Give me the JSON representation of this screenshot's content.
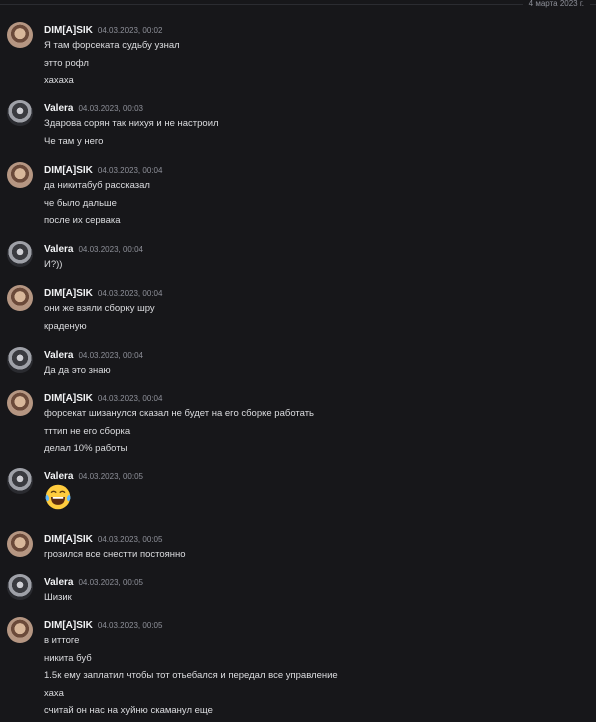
{
  "date_divider": "4 марта 2023 г.",
  "messages": [
    {
      "author": "DIM[A]SIK",
      "time": "04.03.2023, 00:02",
      "lines": [
        "Я там форсеката судьбу узнал",
        "этто рофл",
        "хахаха"
      ]
    },
    {
      "author": "Valera",
      "time": "04.03.2023, 00:03",
      "lines": [
        "Здарова сорян так нихуя и не настроил",
        "Че там у него"
      ]
    },
    {
      "author": "DIM[A]SIK",
      "time": "04.03.2023, 00:04",
      "lines": [
        "да никитабуб рассказал",
        "че было дальше",
        "после их сервака"
      ]
    },
    {
      "author": "Valera",
      "time": "04.03.2023, 00:04",
      "lines": [
        "И?))"
      ]
    },
    {
      "author": "DIM[A]SIK",
      "time": "04.03.2023, 00:04",
      "lines": [
        "они же взяли сборку шру",
        "краденую"
      ]
    },
    {
      "author": "Valera",
      "time": "04.03.2023, 00:04",
      "lines": [
        "Да да это знаю"
      ]
    },
    {
      "author": "DIM[A]SIK",
      "time": "04.03.2023, 00:04",
      "lines": [
        "форсекат шизанулся сказал не будет на его сборке работать",
        "тттип не его сборка",
        "делал 10% работы"
      ]
    },
    {
      "author": "Valera",
      "time": "04.03.2023, 00:05",
      "lines": [],
      "emoji": "laughing-crying-emoji"
    },
    {
      "author": "DIM[A]SIK",
      "time": "04.03.2023, 00:05",
      "lines": [
        "грозился все снестти постоянно"
      ]
    },
    {
      "author": "Valera",
      "time": "04.03.2023, 00:05",
      "lines": [
        "Шизик"
      ]
    },
    {
      "author": "DIM[A]SIK",
      "time": "04.03.2023, 00:05",
      "lines": [
        "в иттоге",
        "никита буб",
        "1.5к ему заплатил чтобы тот отьебался и передал все управление",
        "хаха",
        "считай он нас на хуйню скаманул еще"
      ]
    }
  ]
}
